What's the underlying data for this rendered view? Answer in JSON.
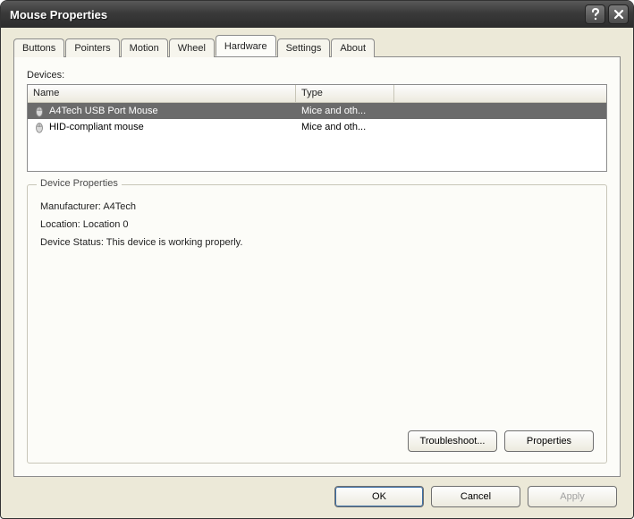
{
  "window": {
    "title": "Mouse Properties"
  },
  "tabs": [
    {
      "label": "Buttons"
    },
    {
      "label": "Pointers"
    },
    {
      "label": "Motion"
    },
    {
      "label": "Wheel"
    },
    {
      "label": "Hardware"
    },
    {
      "label": "Settings"
    },
    {
      "label": "About"
    }
  ],
  "active_tab_index": 4,
  "devices_section": {
    "label": "Devices:",
    "columns": {
      "name": "Name",
      "type": "Type"
    },
    "rows": [
      {
        "name": "A4Tech USB Port Mouse",
        "type": "Mice and oth...",
        "selected": true
      },
      {
        "name": "HID-compliant mouse",
        "type": "Mice and oth...",
        "selected": false
      }
    ]
  },
  "properties_group": {
    "title": "Device Properties",
    "manufacturer_label": "Manufacturer:",
    "manufacturer_value": "A4Tech",
    "location_label": "Location:",
    "location_value": "Location 0",
    "status_label": "Device Status:",
    "status_value": "This device is working properly.",
    "troubleshoot_label": "Troubleshoot...",
    "properties_label": "Properties"
  },
  "bottom_buttons": {
    "ok": "OK",
    "cancel": "Cancel",
    "apply": "Apply"
  }
}
